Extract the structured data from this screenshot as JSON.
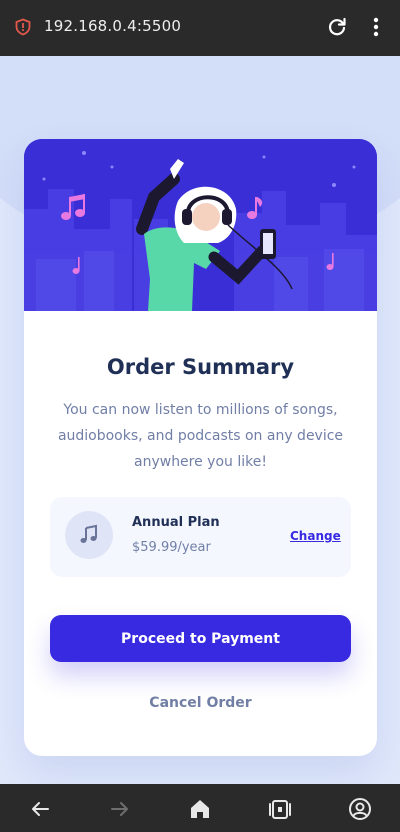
{
  "browser": {
    "url": "192.168.0.4:5500",
    "icons": [
      "shield-icon",
      "reload-icon",
      "menu-icon"
    ]
  },
  "card": {
    "title": "Order Summary",
    "description": "You can now listen to millions of songs, audiobooks, and podcasts on any device anywhere you like!",
    "plan": {
      "name": "Annual Plan",
      "price": "$59.99/year",
      "change_label": "Change",
      "icon": "music-note-icon"
    },
    "primary_button": "Proceed to Payment",
    "cancel_label": "Cancel Order"
  },
  "bottom_nav": {
    "icons": [
      "back-arrow-icon",
      "forward-arrow-icon",
      "home-icon",
      "tabs-icon",
      "account-icon"
    ]
  },
  "colors": {
    "accent": "#382ae1",
    "hero": "#3a2fd6",
    "title": "#1f2f56",
    "text_muted": "#717fa6",
    "background": "#e0e8fb",
    "toolbar": "#2a2a2a"
  }
}
